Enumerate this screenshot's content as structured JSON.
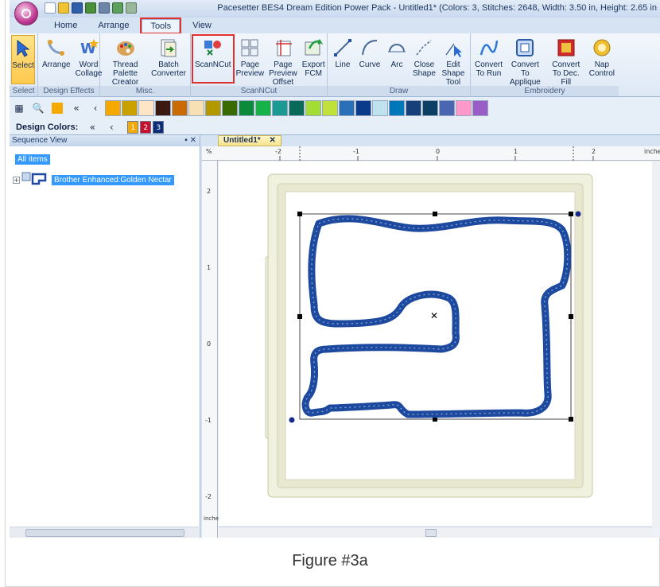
{
  "window": {
    "title": "Pacesetter BES4 Dream Edition Power Pack - Untitled1* (Colors: 3, Stitches: 2648, Width: 3.50 in, Height: 2.65 in"
  },
  "menu": {
    "tabs": [
      {
        "label": "Home"
      },
      {
        "label": "Arrange"
      },
      {
        "label": "Tools"
      },
      {
        "label": "View"
      }
    ],
    "active_tab": "Tools"
  },
  "ribbon": {
    "groups": [
      {
        "label": "Select",
        "buttons": [
          {
            "label": "Select",
            "icon": "cursor-arrow-icon"
          }
        ]
      },
      {
        "label": "Design Effects",
        "buttons": [
          {
            "label": "Arrange",
            "icon": "arrange-icon"
          },
          {
            "label": "Word\nCollage",
            "icon": "word-collage-icon"
          }
        ]
      },
      {
        "label": "Misc.",
        "buttons": [
          {
            "label": "Thread Palette\nCreator",
            "icon": "thread-palette-icon"
          },
          {
            "label": "Batch\nConverter",
            "icon": "batch-converter-icon"
          }
        ]
      },
      {
        "label": "ScanNCut",
        "buttons": [
          {
            "label": "ScanNCut",
            "icon": "scanncut-icon"
          },
          {
            "label": "Page\nPreview",
            "icon": "page-preview-icon"
          },
          {
            "label": "Page Preview\nOffset",
            "icon": "page-preview-offset-icon"
          },
          {
            "label": "Export\nFCM",
            "icon": "export-fcm-icon"
          }
        ]
      },
      {
        "label": "Draw",
        "buttons": [
          {
            "label": "Line",
            "icon": "line-icon"
          },
          {
            "label": "Curve",
            "icon": "curve-icon"
          },
          {
            "label": "Arc",
            "icon": "arc-icon"
          },
          {
            "label": "Close\nShape",
            "icon": "close-shape-icon"
          },
          {
            "label": "Edit Shape\nTool",
            "icon": "edit-shape-icon"
          }
        ]
      },
      {
        "label": "Embroidery",
        "buttons": [
          {
            "label": "Convert\nTo Run",
            "icon": "convert-run-icon"
          },
          {
            "label": "Convert To\nApplique",
            "icon": "convert-applique-icon"
          },
          {
            "label": "Convert\nTo Dec. Fill",
            "icon": "convert-decfill-icon"
          },
          {
            "label": "Nap\nControl",
            "icon": "nap-control-icon"
          }
        ]
      }
    ]
  },
  "palette": {
    "colors": [
      "#f5a800",
      "#c9a200",
      "#fde5c5",
      "#3a1a10",
      "#c96b00",
      "#f7e0b4",
      "#b39800",
      "#3a6b00",
      "#0b8a3a",
      "#17b348",
      "#1a9a92",
      "#0a6a5a",
      "#a3dd33",
      "#c0e03a",
      "#2a70b8",
      "#0a3a8a",
      "#bfe2f0",
      "#0077b8",
      "#15407a",
      "#0c3f63",
      "#4a66b2",
      "#ff99cc",
      "#9a5cc6"
    ],
    "design_colors_label": "Design Colors:",
    "design_colors": [
      {
        "num": "1",
        "color": "#f5a800"
      },
      {
        "num": "2",
        "color": "#c8102e"
      },
      {
        "num": "3",
        "color": "#0b2d7a"
      }
    ]
  },
  "sequence": {
    "title": "Sequence View",
    "all_items": "All items",
    "item_name": "Brother Enhanced:Golden Nectar"
  },
  "document": {
    "tab_label": "Untitled1*",
    "ruler_unit": "inches",
    "h_ticks": [
      "-2",
      "-1",
      "0",
      "1",
      "2"
    ],
    "v_ticks": [
      "2",
      "1",
      "0",
      "-1",
      "-2"
    ],
    "v_unit": "inches"
  },
  "caption": "Figure #3a",
  "colors": {
    "stitch": "#1d4a9e",
    "highlight": "#e03030",
    "selected_item": "#3399ff"
  }
}
